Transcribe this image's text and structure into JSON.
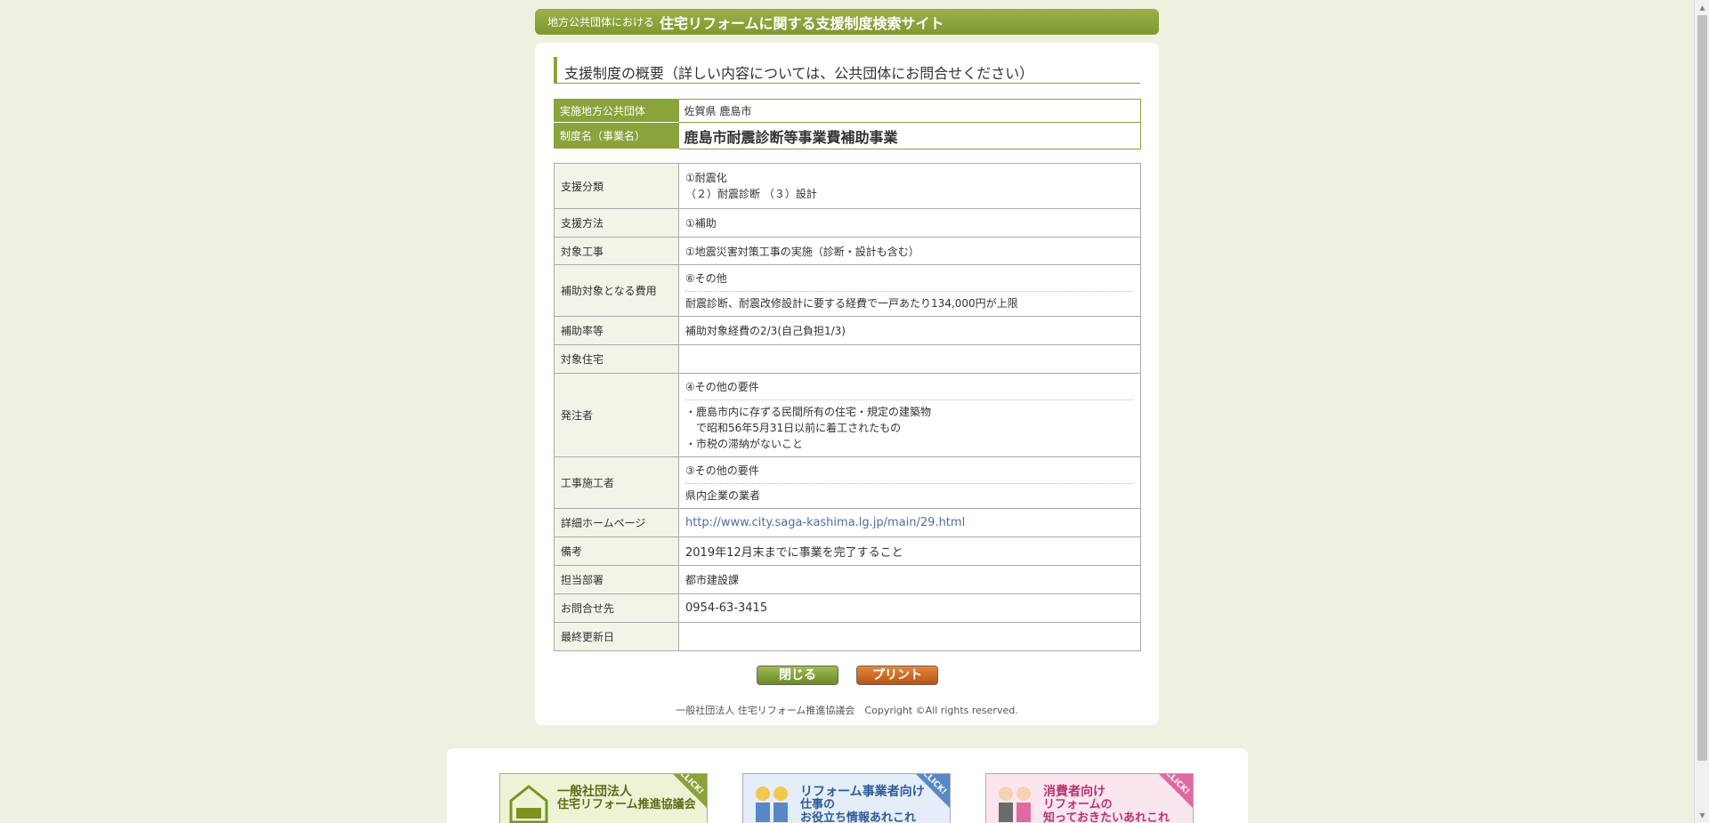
{
  "header": {
    "prefix": "地方公共団体における",
    "title": "住宅リフォームに関する支援制度検索サイト"
  },
  "section_title": "支援制度の概要（詳しい内容については、公共団体にお問合せください）",
  "summary": {
    "org_label": "実施地方公共団体",
    "org_value": "佐賀県 鹿島市",
    "name_label": "制度名（事業名）",
    "name_value": "鹿島市耐震診断等事業費補助事業"
  },
  "details": {
    "support_type_label": "支援分類",
    "support_type_line1": "①耐震化",
    "support_type_line2": "（２）耐震診断 （３）設計",
    "method_label": "支援方法",
    "method_value": "①補助",
    "target_work_label": "対象工事",
    "target_work_value": "①地震災害対策工事の実施（診断・設計も含む）",
    "cost_label": "補助対象となる費用",
    "cost_line1": "⑥その他",
    "cost_line2": "耐震診断、耐震改修設計に要する経費で一戸あたり134,000円が上限",
    "rate_label": "補助率等",
    "rate_value": "補助対象経費の2/3(自己負担1/3)",
    "housing_label": "対象住宅",
    "housing_value": "",
    "client_label": "発注者",
    "client_line1": "④その他の要件",
    "client_line2": "・鹿島市内に存ずる民間所有の住宅・規定の建築物",
    "client_line3": "　で昭和56年5月31日以前に着工されたもの",
    "client_line4": "・市税の滞納がないこと",
    "contractor_label": "工事施工者",
    "contractor_line1": "③その他の要件",
    "contractor_line2": "県内企業の業者",
    "homepage_label": "詳細ホームページ",
    "homepage_url": "http://www.city.saga-kashima.lg.jp/main/29.html",
    "notes_label": "備考",
    "notes_value": "2019年12月末までに事業を完了すること",
    "dept_label": "担当部署",
    "dept_value": "都市建設課",
    "contact_label": "お問合せ先",
    "contact_value": "0954-63-3415",
    "updated_label": "最終更新日",
    "updated_value": ""
  },
  "buttons": {
    "close": "閉じる",
    "print": "プリント"
  },
  "copyright": "一般社団法人 住宅リフォーム推進協議会　Copyright ©All rights reserved.",
  "banners": {
    "b1_title": "一般社団法人",
    "b1_sub": "住宅リフォーム推進協議会",
    "b2_title": "リフォーム事業者向け",
    "b2_sub1": "仕事の",
    "b2_sub2": "お役立ち情報あれこれ",
    "b3_title": "消費者向け",
    "b3_sub1": "リフォームの",
    "b3_sub2": "知っておきたいあれこれ",
    "click": "CLICK!"
  },
  "colors": {
    "accent_green": "#8aa33a",
    "print_orange": "#cc6a22",
    "link_blue": "#4a6fa5",
    "page_bg": "#eef0e0"
  }
}
